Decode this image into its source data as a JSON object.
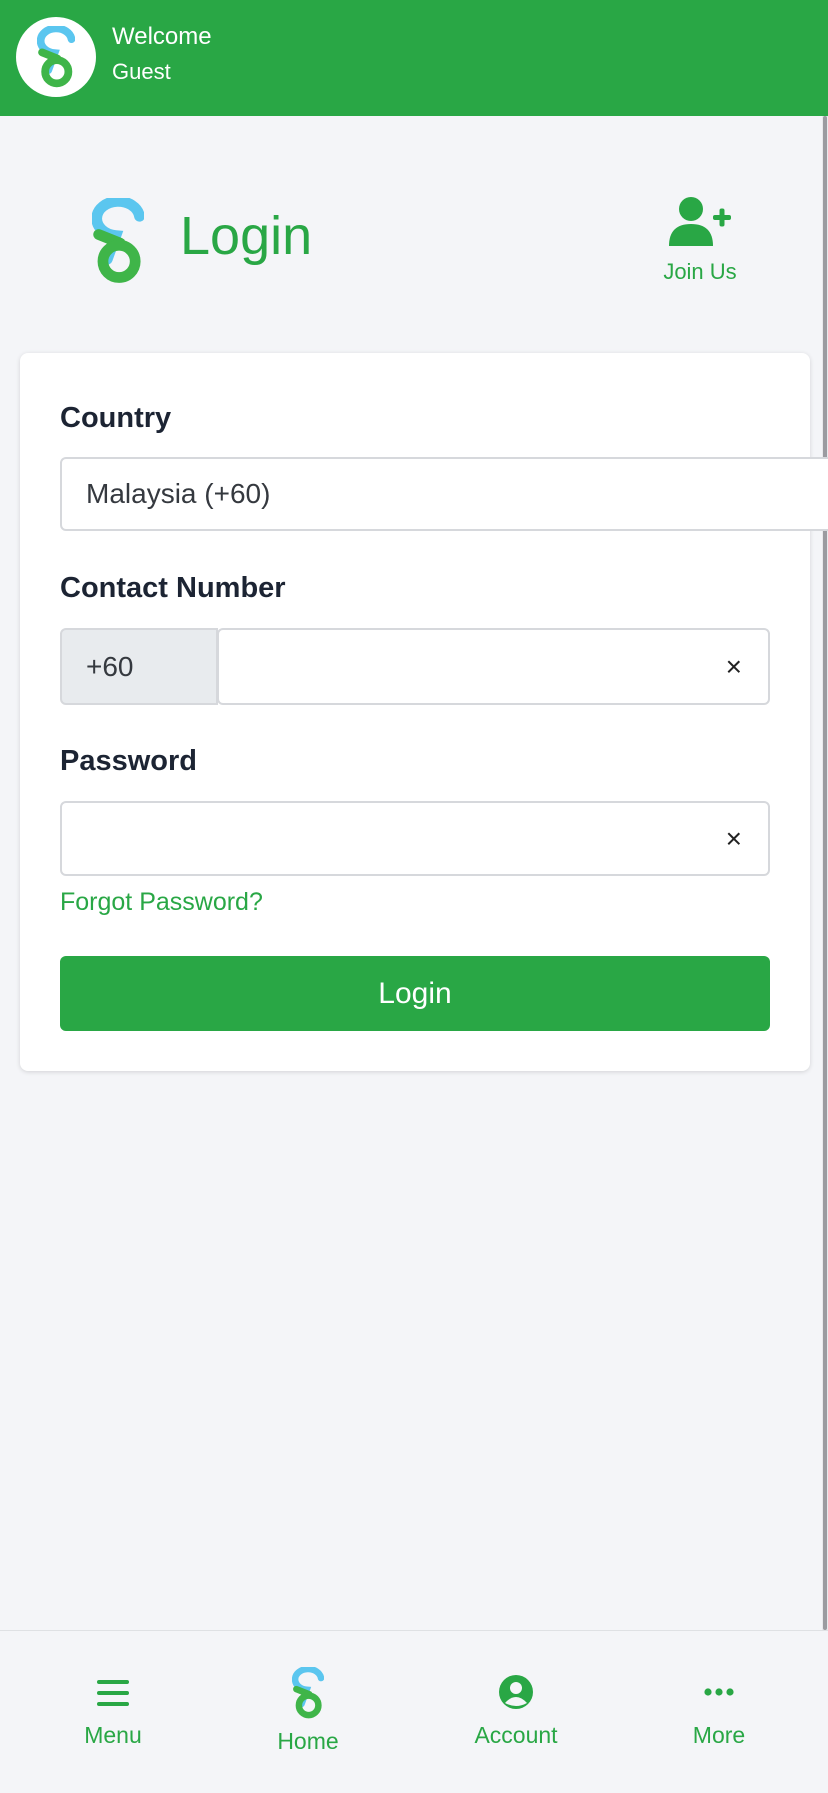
{
  "header": {
    "welcome": "Welcome",
    "user": "Guest",
    "logo_icon": "brand-logo-icon"
  },
  "page": {
    "title": "Login",
    "join_label": "Join Us",
    "join_icon": "user-plus-icon"
  },
  "form": {
    "country_label": "Country",
    "country_value": "Malaysia (+60)",
    "contact_label": "Contact Number",
    "contact_prefix": "+60",
    "contact_value": "",
    "password_label": "Password",
    "password_value": "",
    "clear_glyph": "×",
    "forgot_label": "Forgot Password?",
    "submit_label": "Login"
  },
  "nav": {
    "items": [
      {
        "label": "Menu",
        "icon": "hamburger-menu-icon"
      },
      {
        "label": "Home",
        "icon": "brand-logo-icon"
      },
      {
        "label": "Account",
        "icon": "user-circle-icon"
      },
      {
        "label": "More",
        "icon": "ellipsis-icon"
      }
    ]
  },
  "colors": {
    "primary": "#29a745",
    "logo_blue": "#5bc6ef",
    "logo_green": "#3fb549",
    "background": "#f4f5f8"
  }
}
